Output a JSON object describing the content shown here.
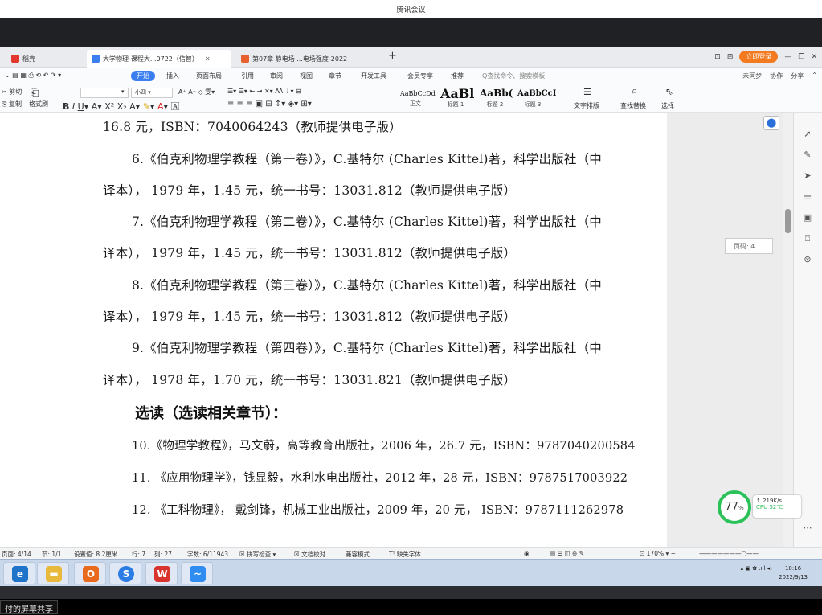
{
  "meeting": {
    "title": "腾讯会议"
  },
  "tabs": [
    {
      "label": "稻壳",
      "color": "#e2372f"
    },
    {
      "label": "大学物理-课程大...0722（信智）",
      "color": "#3a7ef0"
    },
    {
      "label": "第07章 静电场 ...电场强度-2022",
      "color": "#e8612c"
    }
  ],
  "window_right": {
    "login": "立即登录"
  },
  "menu": {
    "start": "开始",
    "items": [
      "插入",
      "页面布局",
      "引用",
      "审阅",
      "视图",
      "章节",
      "开发工具",
      "会员专享",
      "推荐"
    ],
    "search_placeholder": "Q查找命令、搜索模板",
    "right": [
      "未同步",
      "协作",
      "分享"
    ]
  },
  "ribbon": {
    "cut": "剪切",
    "copy": "复制",
    "format_painter": "格式刷",
    "font_size": "小四",
    "styles": [
      {
        "sample": "AaBbCcDd",
        "label": "正文"
      },
      {
        "sample": "AaBl",
        "label": "标题 1"
      },
      {
        "sample": "AaBb(",
        "label": "标题 2"
      },
      {
        "sample": "AaBbCcI",
        "label": "标题 3"
      }
    ],
    "text_layout": "文字排版",
    "find_replace": "查找替换",
    "select": "选择"
  },
  "document": {
    "lines": [
      "16.8 元，ISBN：7040064243（教师提供电子版）",
      "6.《伯克利物理学教程（第一卷）》，C.基特尔 (Charles Kittel)著，科学出版社（中",
      "译本），  1979 年，1.45 元，统一书号：13031.812（教师提供电子版）",
      "7.《伯克利物理学教程（第二卷）》，C.基特尔 (Charles Kittel)著，科学出版社（中",
      "译本），  1979 年，1.45 元，统一书号：13031.812（教师提供电子版）",
      "8.《伯克利物理学教程（第三卷）》，C.基特尔 (Charles Kittel)著，科学出版社（中",
      "译本），  1979 年，1.45 元，统一书号：13031.812（教师提供电子版）",
      "9.《伯克利物理学教程（第四卷）》，C.基特尔 (Charles Kittel)著，科学出版社（中",
      "译本），  1978 年，1.70 元，统一书号：13031.821（教师提供电子版）"
    ],
    "heading": "选读（选读相关章节）：",
    "lines_after": [
      "10.《物理学教程》，马文蔚，高等教育出版社，2006 年，26.7 元，ISBN：9787040200584",
      "11. 《应用物理学》，钱显毅，水利水电出版社，2012 年，28 元，ISBN：9787517003922",
      "12. 《工科物理》， 戴剑锋，机械工业出版社，2009 年，20 元， ISBN：9787111262978"
    ]
  },
  "page_label": "页码: 4",
  "perf": {
    "percent": "77",
    "unit": "%",
    "speed": "↑ 219K/s",
    "cpu": "CPU 52℃"
  },
  "status": {
    "page": "页面: 4/14",
    "section": "节: 1/1",
    "setting": "设置值: 8.2厘米",
    "row": "行: 7",
    "col": "列: 27",
    "words": "字数: 6/11943",
    "spell": "拼写检查",
    "proof": "文档校对",
    "compat": "兼容模式",
    "missing_font": "缺失字体",
    "zoom": "170%"
  },
  "taskbar": {
    "apps": [
      {
        "name": "ie-icon",
        "glyph": "e",
        "color": "#1f73c9"
      },
      {
        "name": "folder-icon",
        "glyph": "▬",
        "color": "#e8b93a"
      },
      {
        "name": "outlook-icon",
        "glyph": "O",
        "color": "#ea6a1d"
      },
      {
        "name": "sogou-icon",
        "glyph": "S",
        "color": "#2a7be4"
      },
      {
        "name": "wps-icon",
        "glyph": "W",
        "color": "#d9332e"
      },
      {
        "name": "meeting-icon",
        "glyph": "~",
        "color": "#2f8cf0"
      }
    ],
    "time": "10:16",
    "date": "2022/9/13"
  },
  "share": {
    "text": "付的屏幕共享"
  }
}
